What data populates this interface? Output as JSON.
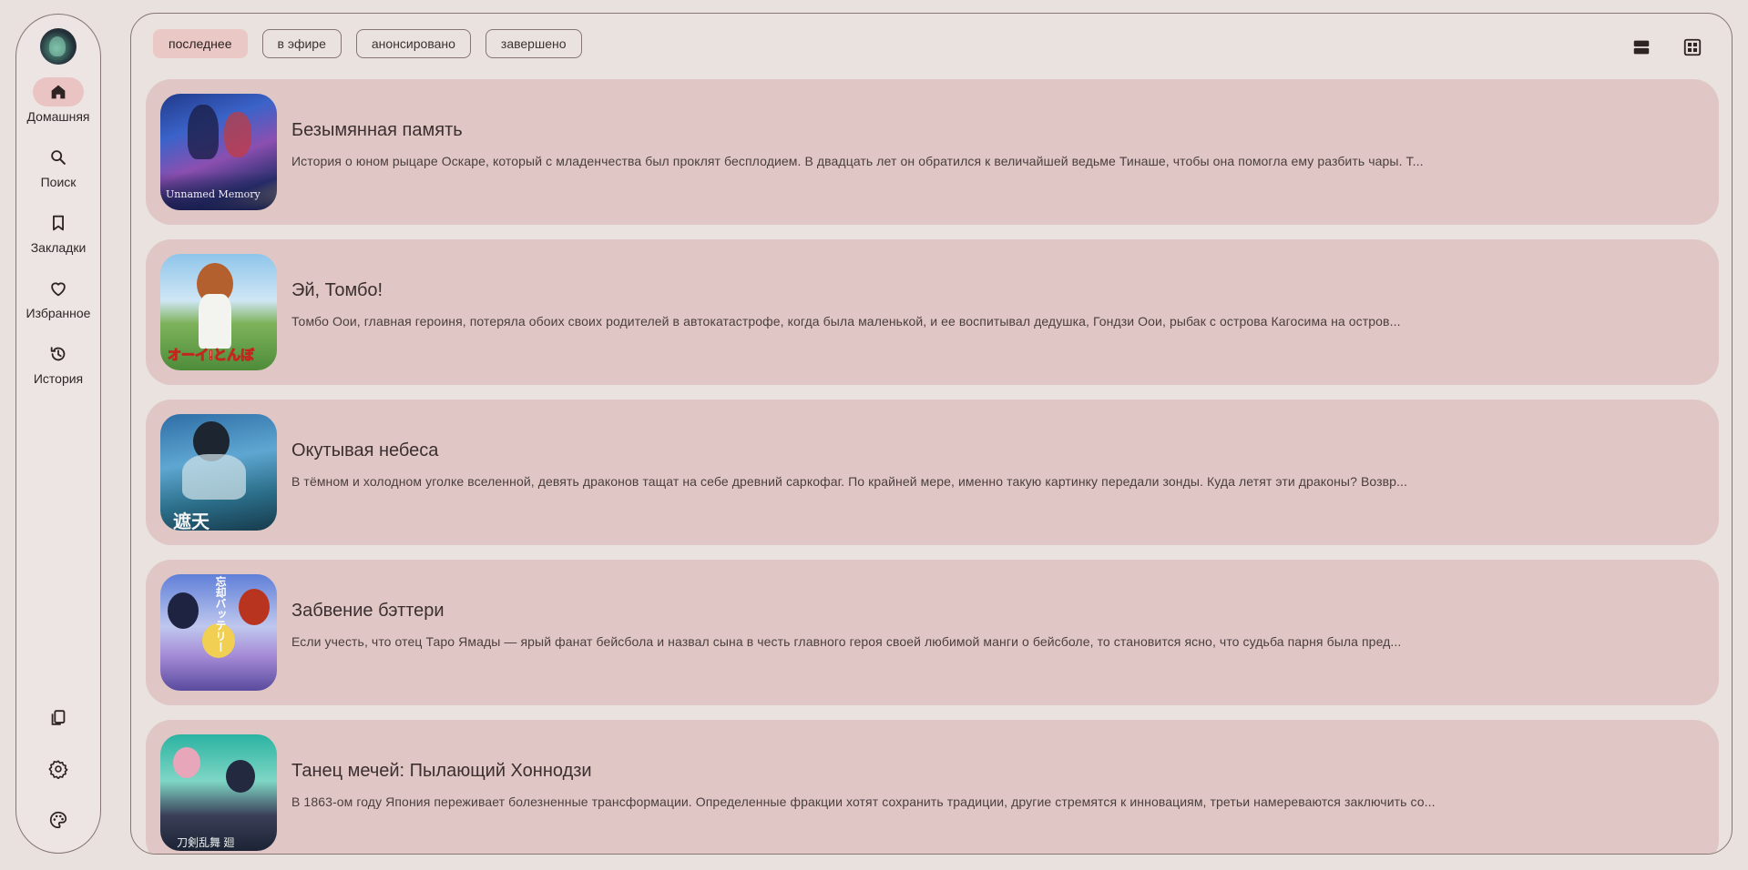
{
  "sidebar": {
    "nav": [
      {
        "id": "home",
        "label": "Домашняя",
        "icon": "home-icon",
        "active": true
      },
      {
        "id": "search",
        "label": "Поиск",
        "icon": "search-icon",
        "active": false
      },
      {
        "id": "bookmarks",
        "label": "Закладки",
        "icon": "bookmark-icon",
        "active": false
      },
      {
        "id": "favorites",
        "label": "Избранное",
        "icon": "heart-icon",
        "active": false
      },
      {
        "id": "history",
        "label": "История",
        "icon": "history-icon",
        "active": false
      }
    ],
    "bottom": [
      {
        "id": "copy",
        "icon": "copy-icon"
      },
      {
        "id": "settings",
        "icon": "gear-icon"
      },
      {
        "id": "theme",
        "icon": "palette-icon"
      }
    ]
  },
  "filters": [
    {
      "label": "последнее",
      "active": true
    },
    {
      "label": "в эфире",
      "active": false
    },
    {
      "label": "анонсировано",
      "active": false
    },
    {
      "label": "завершено",
      "active": false
    }
  ],
  "view_toggles": [
    {
      "id": "list",
      "icon": "list-view-icon"
    },
    {
      "id": "grid",
      "icon": "grid-view-icon"
    }
  ],
  "colors": {
    "background": "#e8e1de",
    "card": "#e0c7c5",
    "accent": "#eac8c6",
    "outline": "#857573"
  },
  "items": [
    {
      "title": "Безымянная память",
      "description": "История о юном рыцаре Оскаре, который с младенчества был проклят бесплодием. В двадцать лет он обратился к величайшей ведьме Тинаше, чтобы она помогла ему разбить чары. Т...",
      "poster_text": "Unnamed Memory"
    },
    {
      "title": "Эй, Томбо!",
      "description": "Томбо Оои, главная героиня, потеряла обоих своих родителей в автокатастрофе, когда была маленькой, и ее воспитывал дедушка, Гондзи Оои, рыбак с острова Кагосима на остров...",
      "poster_text": "オーイ!とんぼ"
    },
    {
      "title": "Окутывая небеса",
      "description": "В тёмном и холодном уголке вселенной, девять драконов тащат на себе древний саркофаг. По крайней мере, именно такую картинку передали зонды. Куда летят эти драконы? Возвр...",
      "poster_text": "遮天"
    },
    {
      "title": "Забвение бэттери",
      "description": "Если учесть, что отец Таро Ямады — ярый фанат бейсбола и назвал сына в честь главного героя своей любимой манги о бейсболе, то становится ясно, что судьба парня была пред...",
      "poster_text": "忘却バッテリー"
    },
    {
      "title": "Танец мечей: Пылающий Хоннодзи",
      "description": "В 1863-ом году Япония переживает болезненные трансформации. Определенные фракции хотят сохранить традиции, другие стремятся к инновациям, третьи намереваются заключить со...",
      "poster_text": "刀剣乱舞 廻"
    }
  ]
}
